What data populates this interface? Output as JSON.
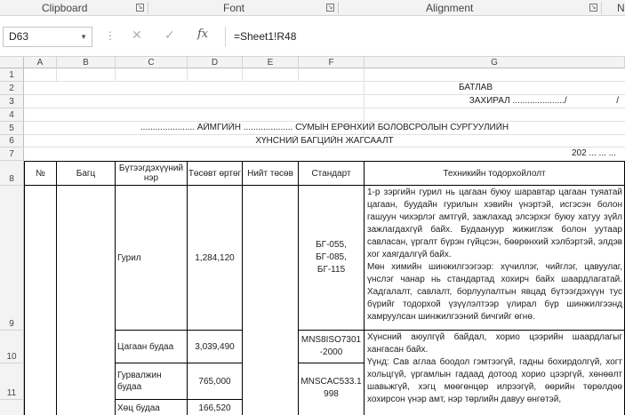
{
  "ribbon": {
    "groups": [
      {
        "label": "Clipboard"
      },
      {
        "label": "Font"
      },
      {
        "label": "Alignment"
      },
      {
        "label": "N"
      }
    ]
  },
  "formula_bar": {
    "name_box": "D63",
    "cancel_glyph": "✕",
    "enter_glyph": "✓",
    "fx_glyph": "fx",
    "formula": "=Sheet1!R48"
  },
  "columns": [
    "A",
    "B",
    "C",
    "D",
    "E",
    "F",
    "G"
  ],
  "rows": [
    "1",
    "2",
    "3",
    "4",
    "5",
    "6",
    "7",
    "8",
    "9",
    "10",
    "11"
  ],
  "sheet": {
    "approve": "БАТЛАВ",
    "director": "ЗАХИРАЛ ...................../                    /",
    "school_line": "...................... АЙМГИЙН .................... СУМЫН ЕРӨНХИЙ БОЛОВСРОЛЫН СУРГУУЛИЙН",
    "subtitle": "ХҮНСНИЙ БАГЦИЙН ЖАГСААЛТ",
    "date": "202 ... ... ...",
    "headers": {
      "no": "№",
      "package": "Багц",
      "product_name": "Бүтээгдэхүүний нэр",
      "budget_price": "Төсөвт өртөг",
      "total_budget": "Нийт төсөв",
      "standard": "Стандарт",
      "tech_spec": "Техникийн тодорхойлолт"
    },
    "items": [
      {
        "name": "Гурил",
        "price": "1,284,120",
        "standard": "БГ-055, БГ-085, БГ-115",
        "spec": "1-р зэргийн гурил нь цагаан буюу шаравтар цагаан туяатай цагаан, буудайн гурилын хэвийн үнэртэй, исгэсэн болон гашуун чихэрлэг амтгүй, зажлахад элсэрхэг буюу хатуу зүйл зажлагдахгүй байх. Будаануур жижиглэж болон уутаар савласан, үргалт бүрэн гүйцсэн, бөөрөнхий хэлбэртэй, элдэв хог хаягдалгүй байх.\nМөн химийн шинжилгээгээр: хүчиллэг, чийглэг, цавуулаг, үнслэг чанар нь стандартад хохирч байх шаардлагатай. Хадгалалт, савлалт, борлуулалтын явцад бүтээгдэхүүн тус бүрийг тодорхой үзүүлэлтээр үлирал бүр шинжилгээнд хамруулсан шинжилгээний бичгийг өгнө."
      },
      {
        "name": "Цагаан будаа",
        "price": "3,039,490",
        "standard": "MNS8ISO7301-2000",
        "spec": "Хүнсний аюулгүй байдал, хорио цээрийн шаардлагыг хангасан байх.\nҮүнд: Сав аглаа боодол гэмтээгүй, гадны бохирдолгүй, хогт хольцгүй, үргамлын гадаад дотоод хорио цээргүй, хөнөөлт шавьжгүй, хэгц мөөгөнцөр илрээгүй, өөрийн төрөлдөө хохирсон үнэр амт, нэр төрлийн давуу өнгөтэй,"
      },
      {
        "name": "Гурвалжин будаа",
        "price": "765,000",
        "standard": "MNSCAC533.1998",
        "spec": ""
      },
      {
        "name": "Хөц будаа",
        "price": "166,520",
        "standard": "",
        "spec": ""
      }
    ]
  }
}
